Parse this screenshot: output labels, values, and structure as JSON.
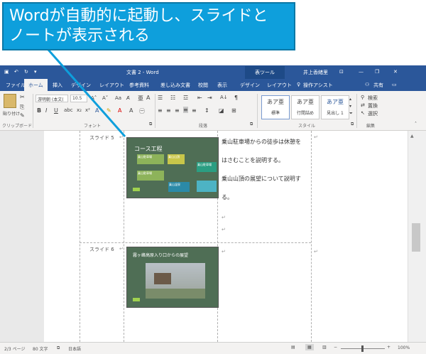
{
  "callout": {
    "line1": "Wordが自動的に起動し、スライドと",
    "line2": "ノートが表示される"
  },
  "titlebar": {
    "doc_title": "文書 2 - Word",
    "context_tab": "表ツール",
    "user": "井上香緒里"
  },
  "ribbon_tabs": [
    "ファイル",
    "ホーム",
    "挿入",
    "デザイン",
    "レイアウト",
    "参考資料",
    "差し込み文書",
    "校閲",
    "表示",
    "デザイン",
    "レイアウト"
  ],
  "tell_me": "操作アシスト",
  "share": "共有",
  "ribbon": {
    "paste": "貼り付け",
    "font_name": "游明朝 (本文(",
    "font_size": "10.5",
    "styles": [
      {
        "preview": "あア亜",
        "name": "標準"
      },
      {
        "preview": "あア亜",
        "name": "行間詰め"
      },
      {
        "preview": "あア亜",
        "name": "見出し 1"
      }
    ],
    "find": "検索",
    "replace": "置換",
    "select": "選択",
    "groups": {
      "clipboard": "クリップボード",
      "font": "フォント",
      "paragraph": "段落",
      "styles": "スタイル",
      "editing": "編集"
    }
  },
  "slides": [
    {
      "label": "スライド 5",
      "title": "コース工程",
      "nodes": [
        "乗山駐車場",
        "乗山山頂",
        "乗山駐車場",
        "乗山温泉",
        "乗山駐車場"
      ],
      "notes": [
        "乗山駐車場からの徒歩は休憩を",
        "はさむことを説明する。",
        "乗山山頂の展望について説明す",
        "る。"
      ]
    },
    {
      "label": "スライド 6",
      "title": "霧ヶ峰高原入り口からの展望",
      "notes": []
    }
  ],
  "status": {
    "page": "2/3 ページ",
    "words": "80 文字",
    "lang": "日本語",
    "zoom": "100%"
  },
  "colors": {
    "word_blue": "#2b579a",
    "callout_blue": "#0e9fdc",
    "slide_green": "#4f6e55"
  }
}
